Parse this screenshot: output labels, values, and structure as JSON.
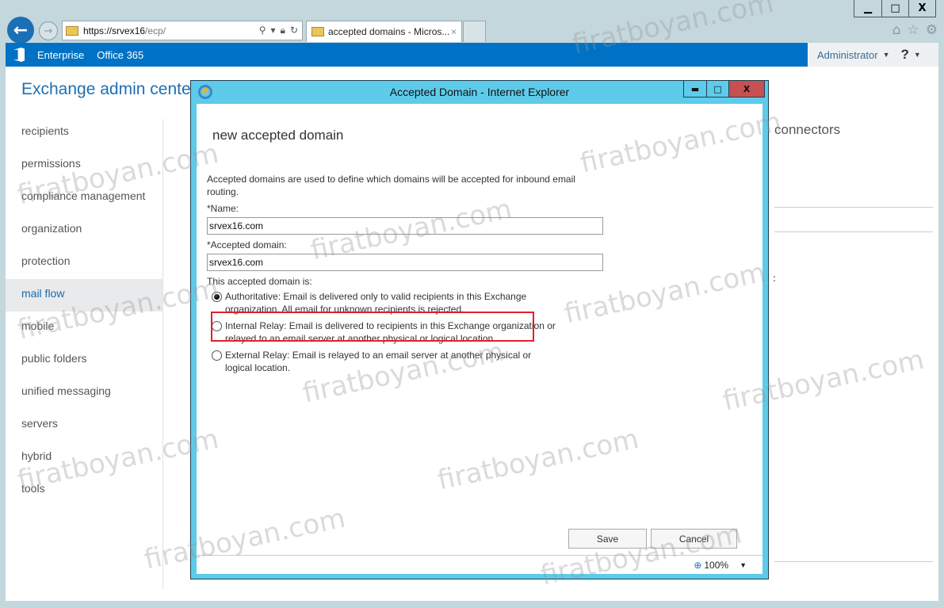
{
  "browser": {
    "window_controls": {
      "minimize": "▁",
      "maximize": "□",
      "close": "X"
    },
    "url_host": "https://srvex16",
    "url_path": "/ecp/",
    "tab_title": "accepted domains - Micros...",
    "tab_close": "×",
    "icons": [
      "home-icon",
      "favorites-star-icon",
      "settings-gear-icon"
    ]
  },
  "o365_bar": {
    "links": [
      "Enterprise",
      "Office 365"
    ],
    "user": "Administrator",
    "help": "?"
  },
  "page": {
    "title": "Exchange admin cente",
    "nav_items": [
      {
        "label": "recipients",
        "active": false
      },
      {
        "label": "permissions",
        "active": false
      },
      {
        "label": "compliance management",
        "active": false
      },
      {
        "label": "organization",
        "active": false
      },
      {
        "label": "protection",
        "active": false
      },
      {
        "label": "mail flow",
        "active": true
      },
      {
        "label": "mobile",
        "active": false
      },
      {
        "label": "public folders",
        "active": false
      },
      {
        "label": "unified messaging",
        "active": false
      },
      {
        "label": "servers",
        "active": false
      },
      {
        "label": "hybrid",
        "active": false
      },
      {
        "label": "tools",
        "active": false
      }
    ],
    "background_heading": "connectors",
    "background_colon": ":"
  },
  "dialog": {
    "window_title": "Accepted Domain - Internet Explorer",
    "heading": "new accepted domain",
    "description": "Accepted domains are used to define which domains will be accepted for inbound email routing.",
    "name_label": "*Name:",
    "name_value": "srvex16.com",
    "domain_label": "*Accepted domain:",
    "domain_value": "srvex16.com",
    "type_label": "This accepted domain is:",
    "options": [
      {
        "label": "Authoritative: Email is delivered only to valid recipients in this Exchange organization. All email for unknown recipients is rejected.",
        "checked": true
      },
      {
        "label": "Internal Relay: Email is delivered to recipients in this Exchange organization or relayed to an email server at another physical or logical location.",
        "checked": false
      },
      {
        "label": "External Relay: Email is relayed to an email server at another physical or logical location.",
        "checked": false
      }
    ],
    "save_label": "Save",
    "cancel_label": "Cancel",
    "zoom_level": "100%"
  },
  "watermark": "firatboyan.com",
  "colors": {
    "accent": "#0072c6",
    "dialog_frame": "#5ecbea",
    "highlight": "#e0202c",
    "close_button": "#c75050"
  }
}
